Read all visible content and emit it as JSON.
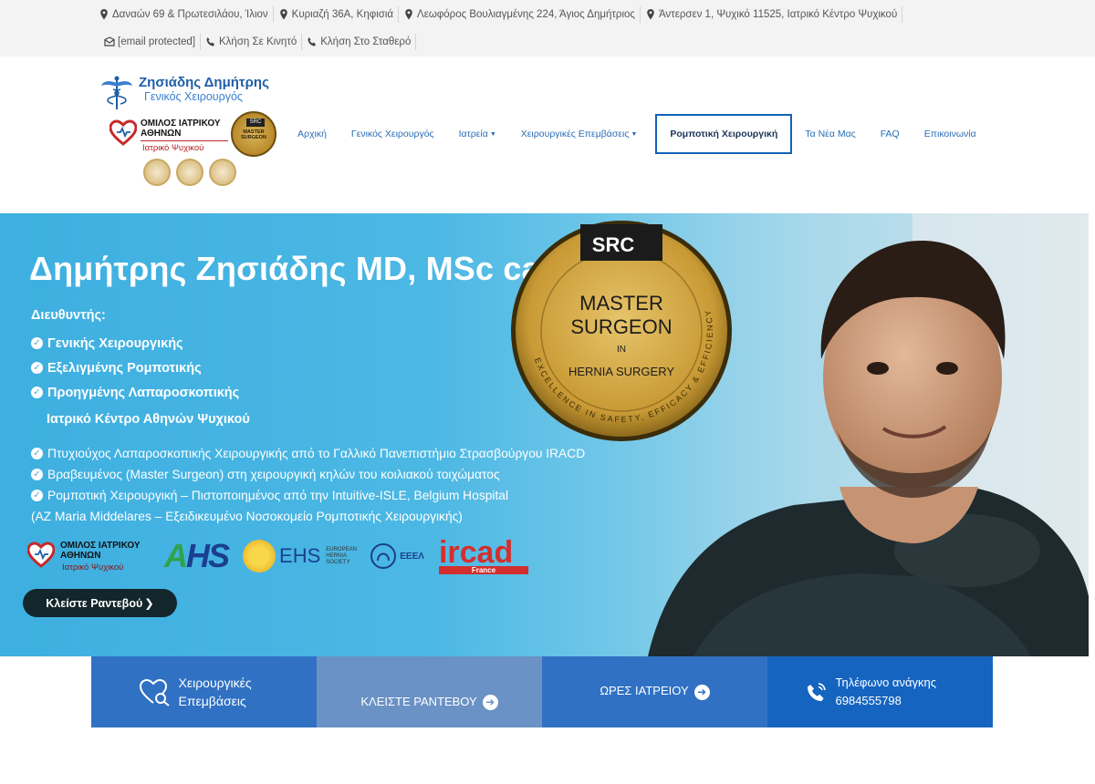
{
  "topbar": {
    "addresses": [
      "Δαναών 69 & Πρωτεσιλάου, Ίλιον",
      "Κυριαζή 36Α, Κηφισιά",
      "Λεωφόρος Βουλιαγμένης 224, Άγιος Δημήτριος",
      "Άντερσεν 1, Ψυχικό 11525, Ιατρικό Κέντρο Ψυχικού"
    ],
    "email": "[email protected]",
    "call_mobile": "Κλήση Σε Κινητό",
    "call_landline": "Κλήση Στο Σταθερό"
  },
  "header": {
    "logo_name": "Ζησιάδης Δημήτρης",
    "logo_subtitle": "Γενικός Χειρουργός",
    "omilos_title": "ΟΜΙΛΟΣ ΙΑΤΡΙΚΟΥ ΑΘΗΝΩΝ",
    "omilos_sub": "Ιατρικό Ψυχικού",
    "badge_src": "SRC",
    "badge_text": "MASTER SURGEON"
  },
  "nav": {
    "items": [
      {
        "label": "Αρχική"
      },
      {
        "label": "Γενικός Χειρουργός"
      },
      {
        "label": "Ιατρεία",
        "dropdown": true
      },
      {
        "label": "Χειρουργικές Επεμβάσεις",
        "dropdown": true
      },
      {
        "label": "Ρομποτική Χειρουργική",
        "active": true
      },
      {
        "label": "Τα Νέα Μας"
      },
      {
        "label": "FAQ"
      },
      {
        "label": "Επικοινωνία"
      }
    ]
  },
  "hero": {
    "title": "Δημήτρης Ζησιάδης MD, MSc ca",
    "director_label": "Διευθυντής:",
    "director_items": [
      "Γενικής Χειρουργικής",
      "Εξελιγμένης Ρομποτικής",
      "Προηγμένης Λαπαροσκοπικής"
    ],
    "center": "Ιατρικό Κέντρο Αθηνών Ψυχικού",
    "credentials": [
      "Πτυχιούχος Λαπαροσκοπικής Χειρουργικής από το Γαλλικό Πανεπιστήμιο Στρασβούργου IRACD",
      "Βραβευμένος (Master Surgeon) στη χειρουργική κηλών του κοιλιακού τοιχώματος",
      "Ρομποτική Χειρουργική – Πιστοποιημένος από την Intuitive-ISLE, Belgium Hospital"
    ],
    "credentials_cont": "(AZ Maria Middelares – Εξειδικευμένο Νοσοκομείο Ρομποτικής Χειρουργικής)",
    "medal": {
      "src": "SRC",
      "line1": "MASTER",
      "line2": "SURGEON",
      "line3": "IN",
      "line4": "HERNIA SURGERY",
      "ring": "EXCELLENCE IN SAFETY, EFFICACY & EFFICIENCY"
    },
    "partners": {
      "omilos_title": "ΟΜΙΛΟΣ ΙΑΤΡΙΚΟΥ ΑΘΗΝΩΝ",
      "omilos_sub": "Ιατρικό Ψυχικού",
      "ahs_a": "A",
      "ahs_rest": "HS",
      "ehs": "EHS",
      "ehs_small": "EUROPEAN HERNIA SOCIETY",
      "ee": "ΕΕΕΛ",
      "ircad": "ircad",
      "ircad_sub": "France"
    },
    "book_button": "Κλείστε Ραντεβού"
  },
  "boxes": {
    "surgeries": "Χειρουργικές Επεμβάσεις",
    "book": "ΚΛΕΙΣΤΕ ΡΑΝΤΕΒΟΥ",
    "hours": "ΩΡΕΣ ΙΑΤΡΕΙΟΥ",
    "emergency_label": "Τηλέφωνο ανάγκης",
    "emergency_phone": "6984555798"
  },
  "colors": {
    "brand_blue": "#1f5ea8",
    "hero_blue": "#3dafe0",
    "button_dark": "#12262c",
    "box_blue": "#3071c3",
    "box_light": "#6a92c5"
  }
}
